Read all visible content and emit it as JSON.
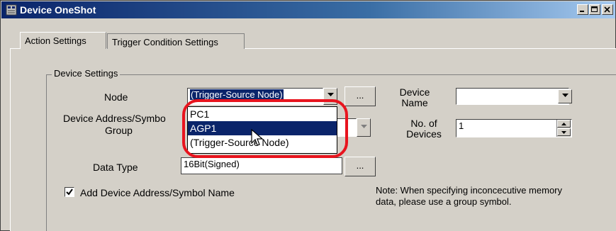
{
  "window": {
    "title": "Device OneShot",
    "controls": [
      "minimize",
      "maximize",
      "close"
    ]
  },
  "tabs": [
    {
      "label": "Action Settings",
      "active": true
    },
    {
      "label": "Trigger Condition Settings",
      "active": false
    }
  ],
  "device_settings": {
    "legend": "Device Settings",
    "node_label": "Node",
    "node_value": "(Trigger-Source Node)",
    "device_address_label_line1": "Device Address/Symbo",
    "device_address_label_line2": "Group",
    "data_type_label": "Data Type",
    "data_type_value": "16Bit(Signed)",
    "device_name_label_line1": "Device",
    "device_name_label_line2": "Name",
    "device_name_value": "",
    "no_of_devices_label_line1": "No. of",
    "no_of_devices_label_line2": "Devices",
    "no_of_devices_value": "1",
    "browse_button_label": "...",
    "add_symbol_checkbox_label": "Add Device Address/Symbol Name",
    "add_symbol_checked": true,
    "note_text": "Note: When specifying inconcecutive memory data, please use a group symbol."
  },
  "node_dropdown": {
    "open": true,
    "options": [
      "PC1",
      "AGP1",
      "(Trigger-Source Node)"
    ],
    "highlighted": "AGP1"
  },
  "colors": {
    "titlebar_start": "#0a246a",
    "selection": "#0a246a",
    "highlight_ring": "#e8141e",
    "face": "#d4d0c8"
  }
}
